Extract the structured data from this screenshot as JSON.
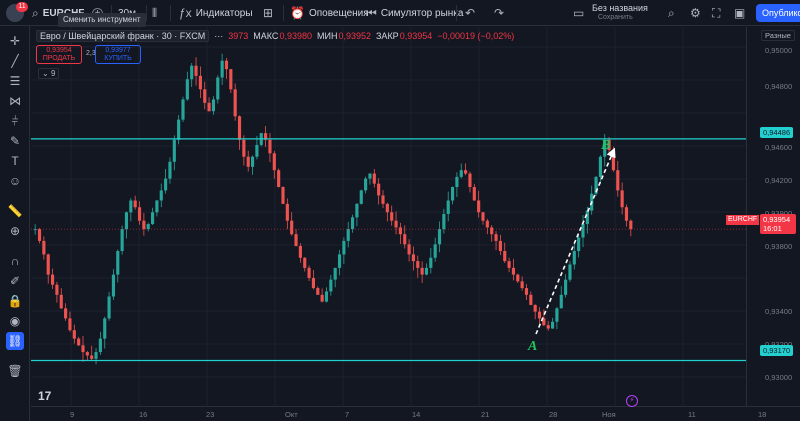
{
  "header": {
    "avatar_badge": "11",
    "symbol": "EURCHF",
    "add_symbol": "+",
    "interval": "30м",
    "tooltip": "Сменить инструмент",
    "indicators_label": "Индикаторы",
    "alerts_label": "Оповещения",
    "replay_label": "Симулятор рынка",
    "layout_title": "Без названия",
    "layout_status": "Сохранить",
    "publish_label": "Опублико"
  },
  "legend": {
    "instrument": "Евро / Швейцарский франк · 30 · FXCM",
    "more": "···",
    "open_value": "3973",
    "high_label": "МАКС",
    "high_value": "0,93980",
    "low_label": "МИН",
    "low_value": "0,93952",
    "close_label": "ЗАКР",
    "close_value": "0,93954",
    "change": "−0,00019 (−0,02%)",
    "sell_price": "0,93954",
    "sell_label": "ПРОДАТЬ",
    "spread": "2,3",
    "buy_price": "0,93977",
    "buy_label": "КУПИТЬ",
    "indicators_count": "9"
  },
  "price_scale": {
    "mode": "Разные",
    "labels": [
      "0,95000",
      "0,94800",
      "0,94600",
      "0,94200",
      "0,93900",
      "0,93800",
      "0,93400",
      "0,93200",
      "0,93000"
    ],
    "level_upper": "0,94486",
    "level_lower": "0,93170",
    "symbol_tag": "EURCHF",
    "current_price": "0,93954",
    "countdown": "16:01"
  },
  "time_scale": {
    "labels": [
      "9",
      "16",
      "23",
      "Окт",
      "7",
      "14",
      "21",
      "28",
      "Ноя",
      "11",
      "18"
    ]
  },
  "annotations": {
    "point_a": "A",
    "point_b": "B"
  },
  "colors": {
    "background": "#131722",
    "up": "#26a69a",
    "down": "#ef5350",
    "level_line": "#22d0d0",
    "annotation": "#22c55e",
    "accent": "#2962ff"
  },
  "chart_data": {
    "type": "candlestick",
    "symbol": "EURCHF",
    "interval": "30",
    "close": [
      0.9395,
      0.9388,
      0.938,
      0.9368,
      0.9362,
      0.9356,
      0.9348,
      0.9342,
      0.9335,
      0.933,
      0.9326,
      0.9322,
      0.932,
      0.9318,
      0.9322,
      0.933,
      0.9342,
      0.9355,
      0.9368,
      0.9382,
      0.9395,
      0.9405,
      0.9412,
      0.9408,
      0.94,
      0.9395,
      0.9398,
      0.9405,
      0.9412,
      0.9418,
      0.9425,
      0.9435,
      0.9448,
      0.946,
      0.9472,
      0.9484,
      0.9492,
      0.9486,
      0.9478,
      0.947,
      0.9465,
      0.9472,
      0.9485,
      0.9495,
      0.949,
      0.9478,
      0.9462,
      0.9448,
      0.9438,
      0.9432,
      0.9438,
      0.9445,
      0.9452,
      0.9448,
      0.944,
      0.943,
      0.942,
      0.941,
      0.94,
      0.9392,
      0.9385,
      0.9378,
      0.9372,
      0.9366,
      0.936,
      0.9356,
      0.9352,
      0.9358,
      0.9365,
      0.9372,
      0.938,
      0.9388,
      0.9395,
      0.9402,
      0.941,
      0.9418,
      0.9425,
      0.9428,
      0.9422,
      0.9415,
      0.941,
      0.9405,
      0.94,
      0.9396,
      0.9392,
      0.9386,
      0.938,
      0.9376,
      0.9372,
      0.9368,
      0.9372,
      0.9378,
      0.9386,
      0.9395,
      0.9404,
      0.9412,
      0.942,
      0.9426,
      0.943,
      0.9428,
      0.942,
      0.9412,
      0.9405,
      0.94,
      0.9396,
      0.9392,
      0.9388,
      0.9382,
      0.9376,
      0.9372,
      0.9368,
      0.9364,
      0.936,
      0.9356,
      0.935,
      0.9346,
      0.9342,
      0.9338,
      0.9336,
      0.934,
      0.9348,
      0.9356,
      0.9365,
      0.9374,
      0.9382,
      0.939,
      0.9398,
      0.9406,
      0.9416,
      0.9426,
      0.9438,
      0.9448,
      0.9442,
      0.943,
      0.9418,
      0.9408,
      0.94,
      0.9395
    ],
    "levels": [
      0.94486,
      0.9317
    ],
    "ylim": [
      0.929,
      0.9515
    ]
  }
}
